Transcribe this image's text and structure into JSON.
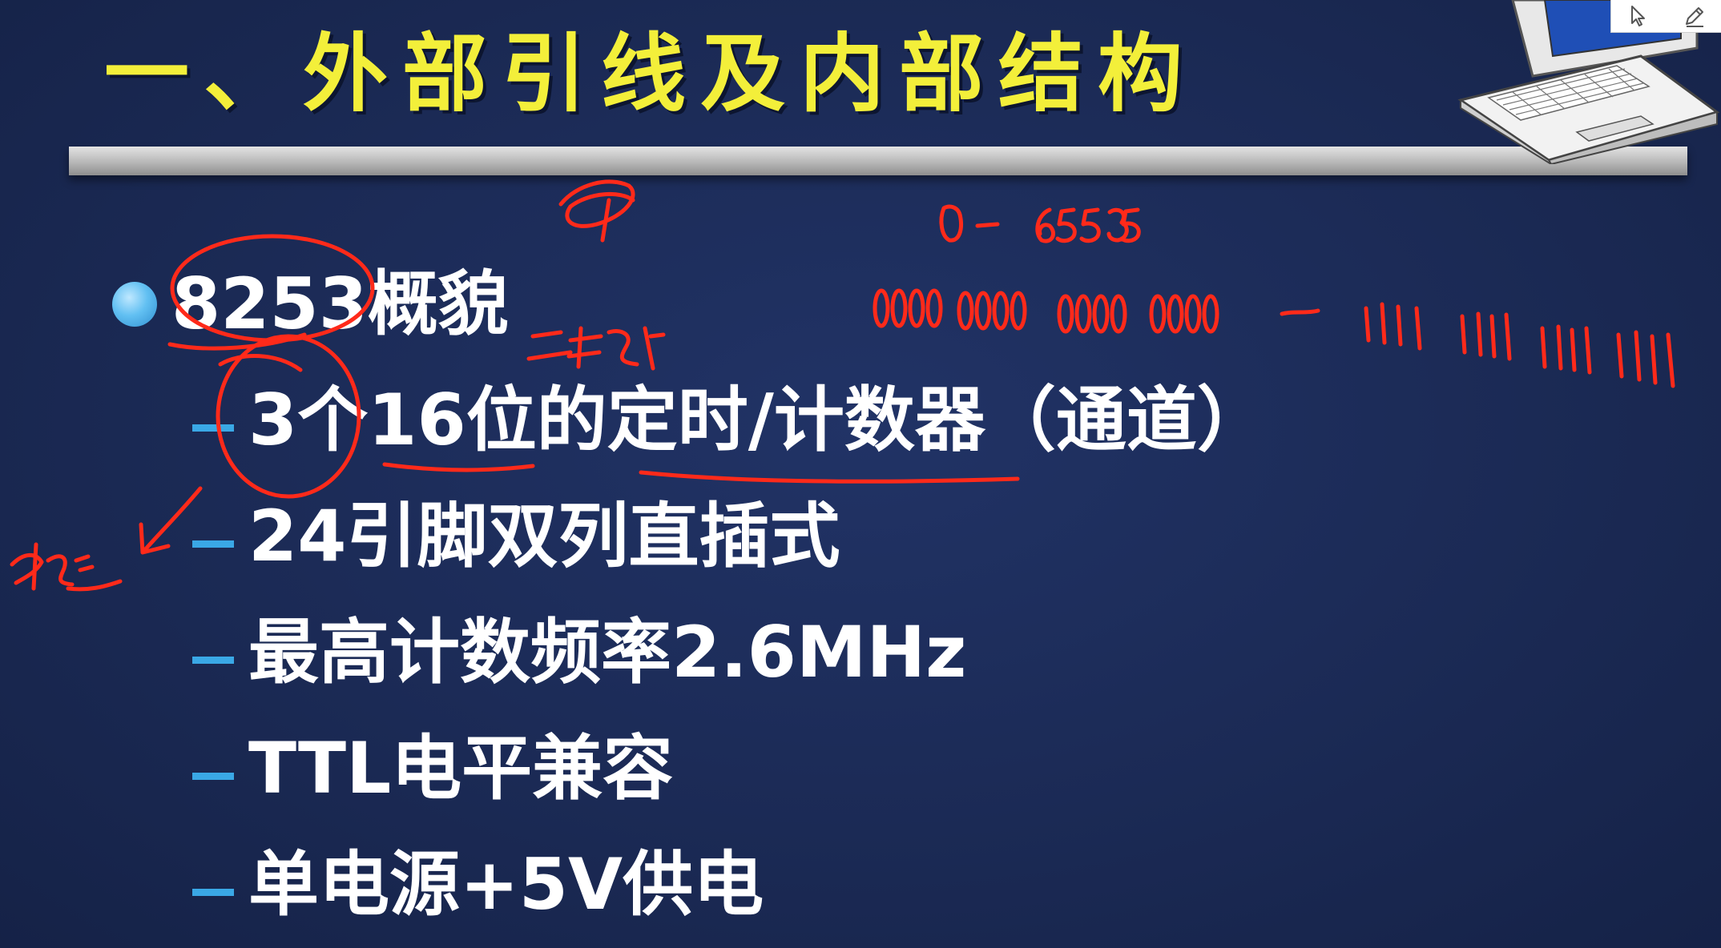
{
  "slide": {
    "title": "一、外部引线及内部结构",
    "bullet": {
      "label": "8253概貌"
    },
    "sub_items": [
      {
        "label": "3个16位的定时/计数器（通道）"
      },
      {
        "label": "24引脚双列直插式"
      },
      {
        "label": "最高计数频率2.6MHz"
      },
      {
        "label": "TTL电平兼容"
      },
      {
        "label": "单电源+5V供电"
      }
    ]
  },
  "toolbar": {
    "icons": [
      "pointer-icon",
      "pen-icon"
    ]
  },
  "colors": {
    "background": "#1b2a52",
    "title": "#f3ef3a",
    "text": "#ffffff",
    "bullet": "#62c0f2",
    "dash": "#3aa8e6",
    "ink": "#ff2a1a"
  }
}
